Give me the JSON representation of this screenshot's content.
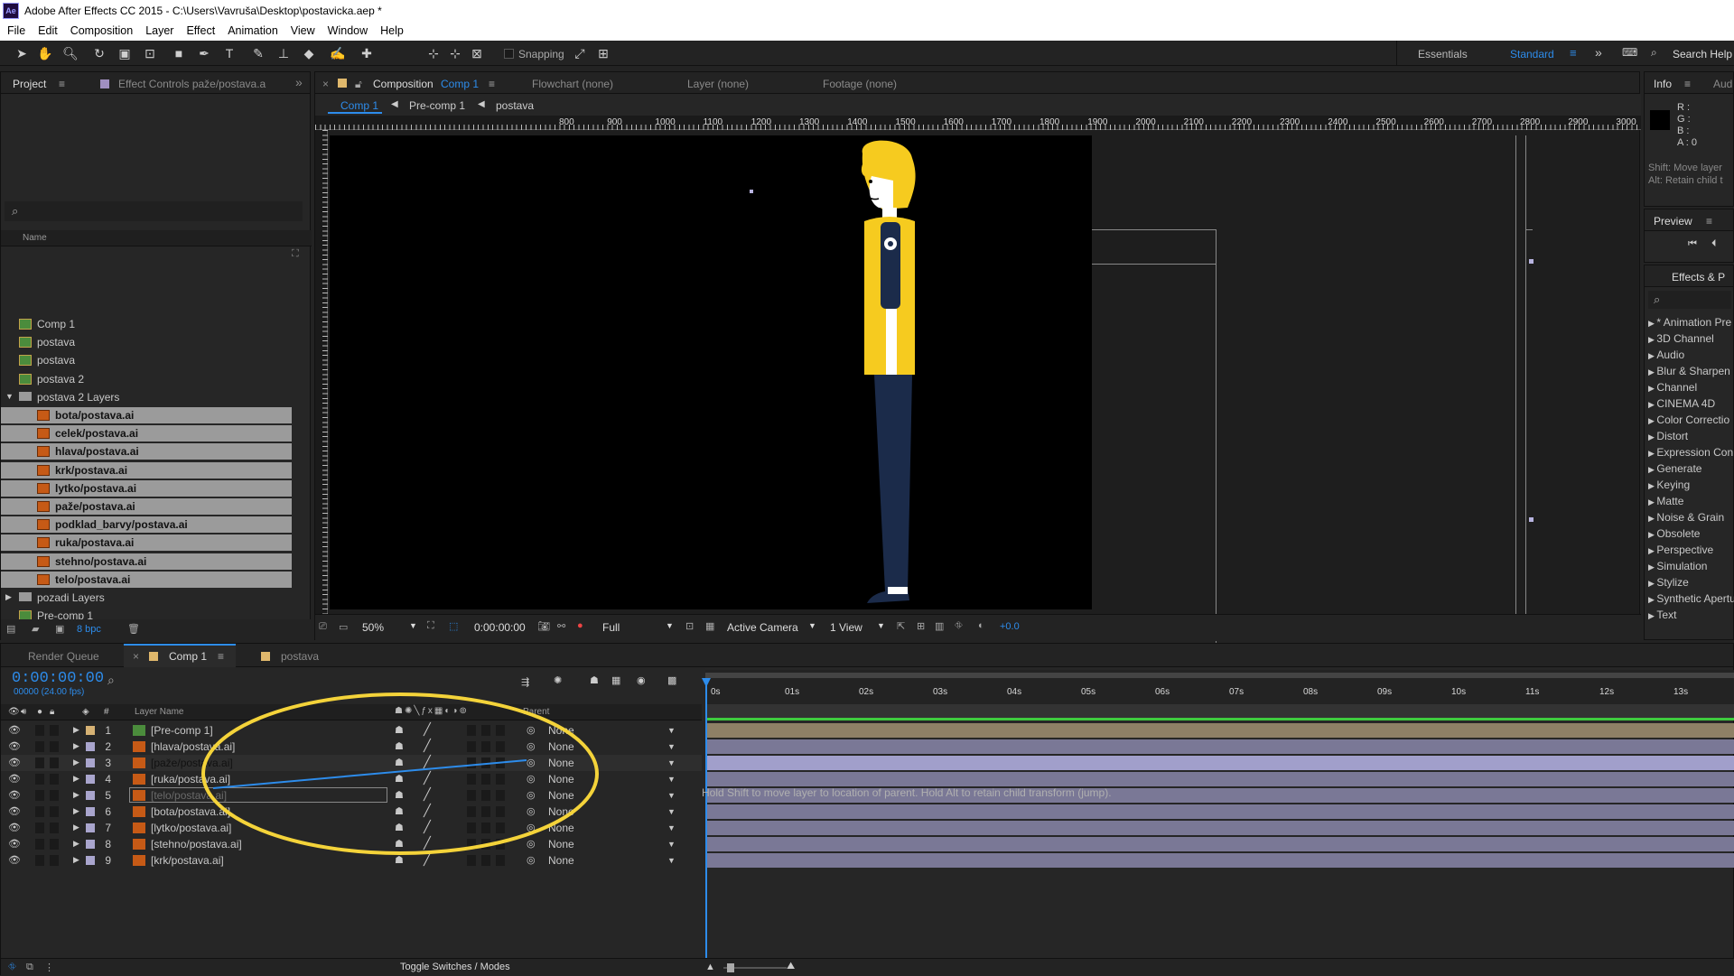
{
  "app": {
    "icon": "Ae",
    "title": "Adobe After Effects CC 2015 - C:\\Users\\Vavruša\\Desktop\\postavicka.aep *"
  },
  "menu": [
    "File",
    "Edit",
    "Composition",
    "Layer",
    "Effect",
    "Animation",
    "View",
    "Window",
    "Help"
  ],
  "toolbar": {
    "snapping": "Snapping",
    "workspace_essentials": "Essentials",
    "workspace_standard": "Standard",
    "search_help": "Search Help"
  },
  "project_panel": {
    "tab_project": "Project",
    "tab_effect_controls": "Effect Controls paže/postava.a",
    "col_name": "Name",
    "items": [
      {
        "name": "Comp 1",
        "type": "comp",
        "selected": false,
        "indent": 0
      },
      {
        "name": "postava",
        "type": "comp",
        "selected": false,
        "indent": 0
      },
      {
        "name": "postava",
        "type": "comp",
        "selected": false,
        "indent": 0
      },
      {
        "name": "postava 2",
        "type": "comp",
        "selected": false,
        "indent": 0
      },
      {
        "name": "postava 2 Layers",
        "type": "folder-open",
        "selected": false,
        "indent": 0
      },
      {
        "name": "bota/postava.ai",
        "type": "ai",
        "selected": true,
        "indent": 1
      },
      {
        "name": "celek/postava.ai",
        "type": "ai",
        "selected": true,
        "indent": 1
      },
      {
        "name": "hlava/postava.ai",
        "type": "ai",
        "selected": true,
        "indent": 1
      },
      {
        "name": "krk/postava.ai",
        "type": "ai",
        "selected": true,
        "indent": 1
      },
      {
        "name": "lytko/postava.ai",
        "type": "ai",
        "selected": true,
        "indent": 1
      },
      {
        "name": "paže/postava.ai",
        "type": "ai",
        "selected": true,
        "indent": 1
      },
      {
        "name": "podklad_barvy/postava.ai",
        "type": "ai",
        "selected": true,
        "indent": 1
      },
      {
        "name": "ruka/postava.ai",
        "type": "ai",
        "selected": true,
        "indent": 1
      },
      {
        "name": "stehno/postava.ai",
        "type": "ai",
        "selected": true,
        "indent": 1
      },
      {
        "name": "telo/postava.ai",
        "type": "ai",
        "selected": true,
        "indent": 1
      },
      {
        "name": "pozadi Layers",
        "type": "folder-closed",
        "selected": false,
        "indent": 0
      },
      {
        "name": "Pre-comp 1",
        "type": "comp",
        "selected": false,
        "indent": 0
      }
    ],
    "bpc": "8 bpc"
  },
  "composition_panel": {
    "tab_label": "Composition",
    "tab_comp_name": "Comp 1",
    "tab_flowchart": "Flowchart (none)",
    "tab_layer": "Layer (none)",
    "tab_footage": "Footage (none)",
    "breadcrumbs": [
      "Comp 1",
      "Pre-comp 1",
      "postava"
    ],
    "ruler_labels": [
      "800",
      "900",
      "1000",
      "1100",
      "1200",
      "1300",
      "1400",
      "1500",
      "1600",
      "1700",
      "1800",
      "1900",
      "2000",
      "2100",
      "2200",
      "2300",
      "2400",
      "2500",
      "2600",
      "2700",
      "2800",
      "2900",
      "3000"
    ],
    "zoom": "50%",
    "timecode": "0:00:00:00",
    "resolution": "Full",
    "camera": "Active Camera",
    "views": "1 View",
    "exposure": "+0.0"
  },
  "info_panel": {
    "tab_info": "Info",
    "tab_audio": "Aud",
    "r": "R :",
    "g": "G :",
    "b": "B :",
    "a": "A : 0",
    "hint1": "Shift: Move layer",
    "hint2": "Alt: Retain child t",
    "preview": "Preview",
    "effects_tab": "Effects & P",
    "effects": [
      "* Animation Pre",
      "3D Channel",
      "Audio",
      "Blur & Sharpen",
      "Channel",
      "CINEMA 4D",
      "Color Correctio",
      "Distort",
      "Expression Con",
      "Generate",
      "Keying",
      "Matte",
      "Noise & Grain",
      "Obsolete",
      "Perspective",
      "Simulation",
      "Stylize",
      "Synthetic Apertu",
      "Text"
    ]
  },
  "timeline": {
    "tab_render_queue": "Render Queue",
    "tab_comp1": "Comp 1",
    "tab_postava": "postava",
    "timecode": "0:00:00:00",
    "fps": "00000 (24.00 fps)",
    "col_layer_name": "Layer Name",
    "col_parent": "Parent",
    "hash": "#",
    "layers": [
      {
        "num": "1",
        "name": "[Pre-comp 1]",
        "type": "comp",
        "parent": "None"
      },
      {
        "num": "2",
        "name": "[hlava/postava.ai]",
        "type": "ai",
        "parent": "None"
      },
      {
        "num": "3",
        "name": "[paže/postava.ai]",
        "type": "ai",
        "parent": "None"
      },
      {
        "num": "4",
        "name": "[ruka/postava.ai]",
        "type": "ai",
        "parent": "None"
      },
      {
        "num": "5",
        "name": "[telo/postava.ai]",
        "type": "ai",
        "parent": "None"
      },
      {
        "num": "6",
        "name": "[bota/postava.ai]",
        "type": "ai",
        "parent": "None"
      },
      {
        "num": "7",
        "name": "[lytko/postava.ai]",
        "type": "ai",
        "parent": "None"
      },
      {
        "num": "8",
        "name": "[stehno/postava.ai]",
        "type": "ai",
        "parent": "None"
      },
      {
        "num": "9",
        "name": "[krk/postava.ai]",
        "type": "ai",
        "parent": "None"
      }
    ],
    "ticks": [
      "0s",
      "01s",
      "02s",
      "03s",
      "04s",
      "05s",
      "06s",
      "07s",
      "08s",
      "09s",
      "10s",
      "11s",
      "12s",
      "13s"
    ],
    "hint": "Hold Shift to move layer to location of parent. Hold Alt to retain child transform (jump).",
    "toggle": "Toggle Switches / Modes"
  },
  "colors": {
    "accent": "#2d8ceb",
    "annotation": "#f4d33a",
    "layer_bar": "#8583a1",
    "selected_row": "#9b9b9b"
  }
}
